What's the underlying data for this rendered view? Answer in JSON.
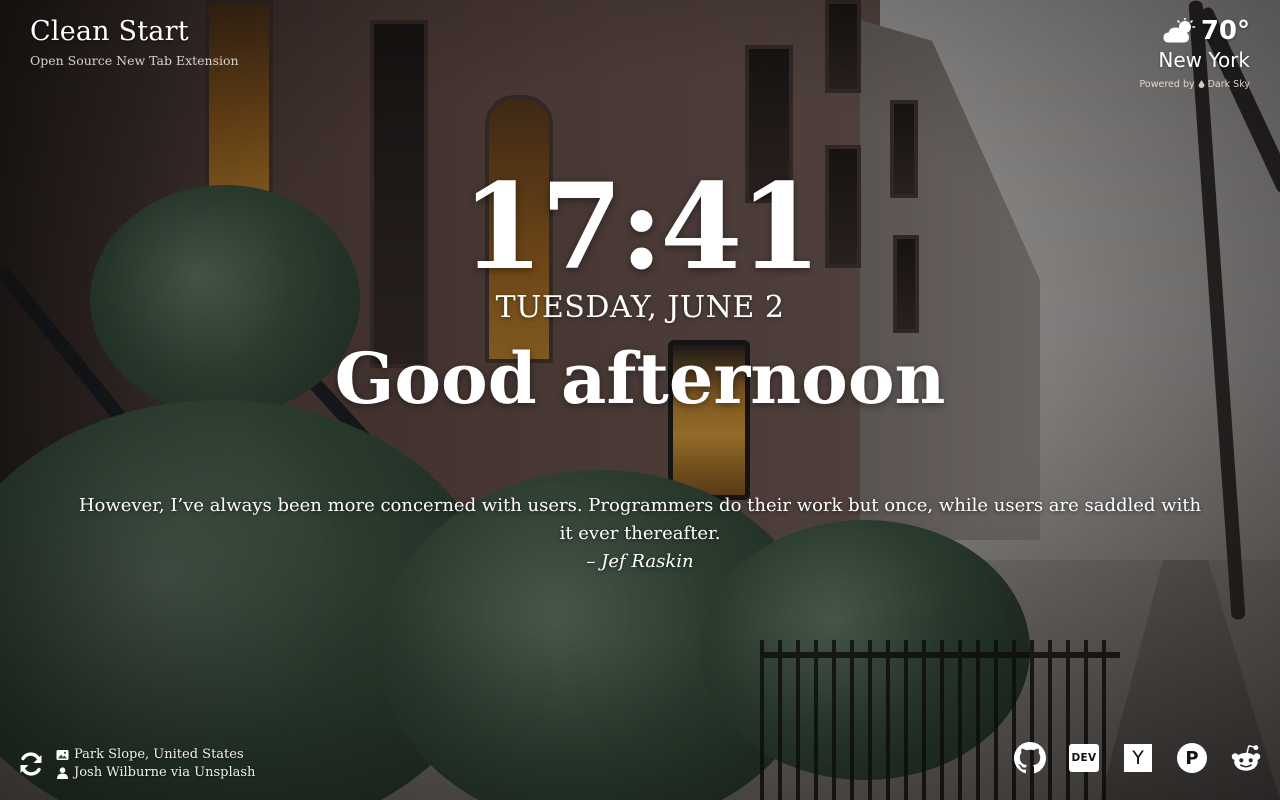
{
  "app": {
    "title": "Clean Start",
    "subtitle": "Open Source New Tab Extension"
  },
  "weather": {
    "temperature": "70°",
    "city": "New York",
    "powered_by": "Powered by",
    "provider": "Dark Sky",
    "icon": "partly-cloudy-icon"
  },
  "clock": {
    "time": "17:41",
    "date": "TUESDAY, JUNE 2"
  },
  "greeting": "Good afternoon",
  "quote": {
    "text": "However, I’ve always been more concerned with users. Programmers do their work but once, while users are saddled with it ever thereafter.",
    "author": "– Jef Raskin"
  },
  "photo_credit": {
    "location": "Park Slope, United States",
    "author": "Josh Wilburne via Unsplash",
    "refresh_icon": "refresh-icon",
    "location_icon": "image-icon",
    "author_icon": "user-icon"
  },
  "links": [
    {
      "name": "GitHub",
      "icon": "github-icon"
    },
    {
      "name": "DEV",
      "label": "DEV",
      "icon": "dev-icon"
    },
    {
      "name": "Hacker News",
      "label": "Y",
      "icon": "hacker-news-icon"
    },
    {
      "name": "Product Hunt",
      "label": "P",
      "icon": "product-hunt-icon"
    },
    {
      "name": "Reddit",
      "icon": "reddit-icon"
    }
  ],
  "colors": {
    "text": "#ffffff",
    "overlay": "rgba(10,10,10,0.38)"
  }
}
